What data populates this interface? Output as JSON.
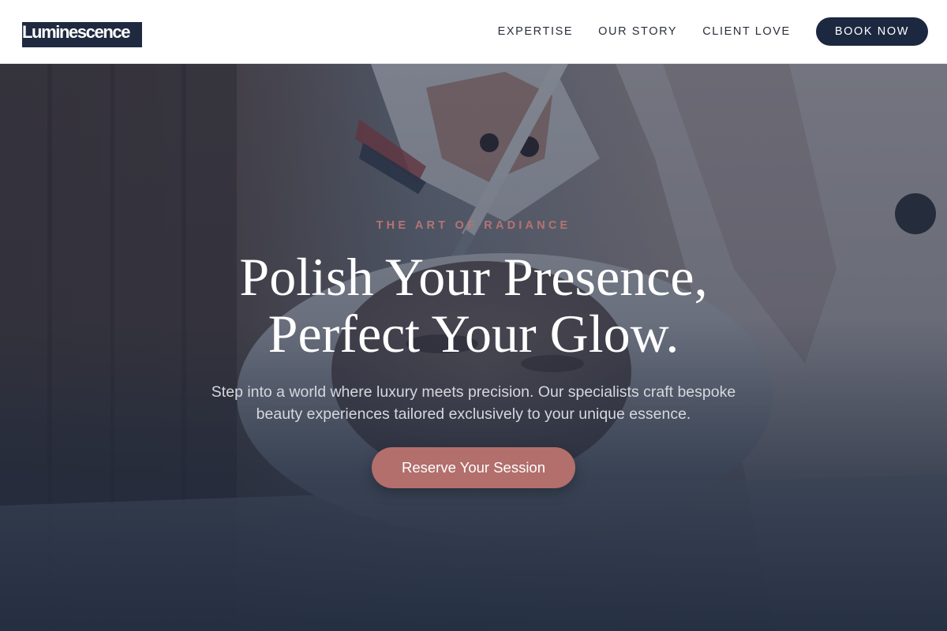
{
  "brand": {
    "name": "Luminescence"
  },
  "nav": {
    "links": [
      {
        "label": "EXPERTISE"
      },
      {
        "label": "OUR STORY"
      },
      {
        "label": "CLIENT LOVE"
      }
    ],
    "cta_label": "BOOK NOW"
  },
  "hero": {
    "eyebrow": "THE ART OF RADIANCE",
    "headline_line1": "Polish Your Presence,",
    "headline_line2": "Perfect Your Glow.",
    "subtext": "Step into a world where luxury meets precision. Our specialists craft bespoke beauty experiences tailored exclusively to your unique essence.",
    "cta_label": "Reserve Your Session",
    "image_subject": "makeup-brush-application-photo"
  },
  "colors": {
    "navy": "#1c2840",
    "rose": "#b26f6c",
    "eyebrow_rose": "#b47472",
    "white": "#ffffff"
  }
}
